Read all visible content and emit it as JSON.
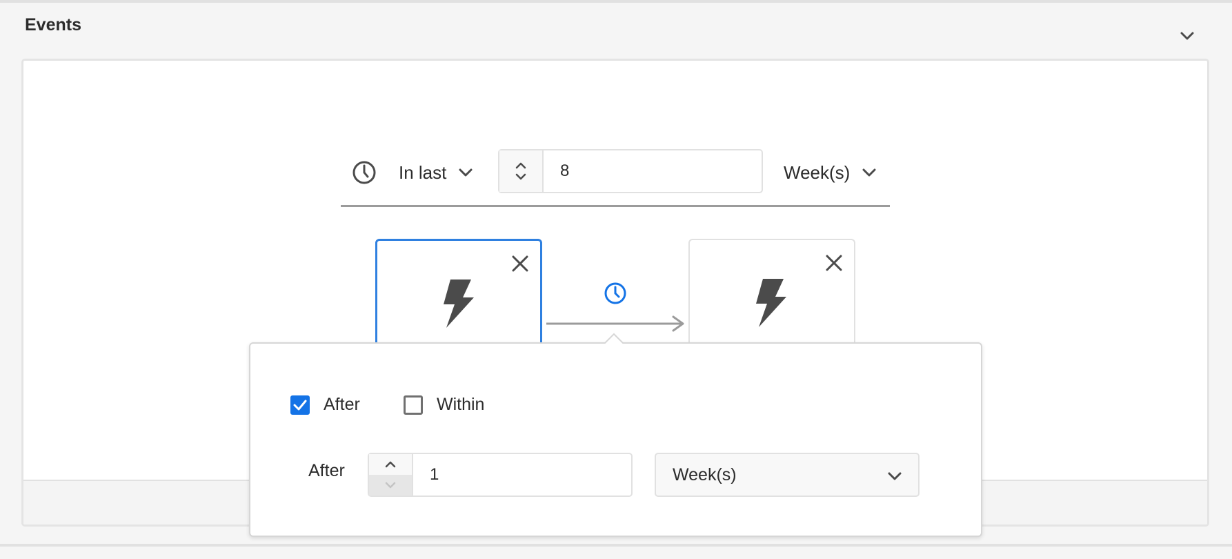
{
  "section": {
    "title": "Events"
  },
  "timeframe": {
    "mode": "In last",
    "value": "8",
    "unit": "Week(s)"
  },
  "sequence": {
    "events": [
      {
        "id": "event-1",
        "selected": true,
        "icon": "lightning-icon"
      },
      {
        "id": "event-2",
        "selected": false,
        "icon": "lightning-icon"
      }
    ],
    "connector_icon": "clock-icon"
  },
  "popover": {
    "options": [
      {
        "label": "After",
        "checked": true
      },
      {
        "label": "Within",
        "checked": false
      }
    ],
    "after_label": "After",
    "after_value": "1",
    "unit": "Week(s)"
  },
  "colors": {
    "accent": "#1473e6",
    "selected_border": "#2f80e0",
    "icon": "#4b4b4b"
  }
}
